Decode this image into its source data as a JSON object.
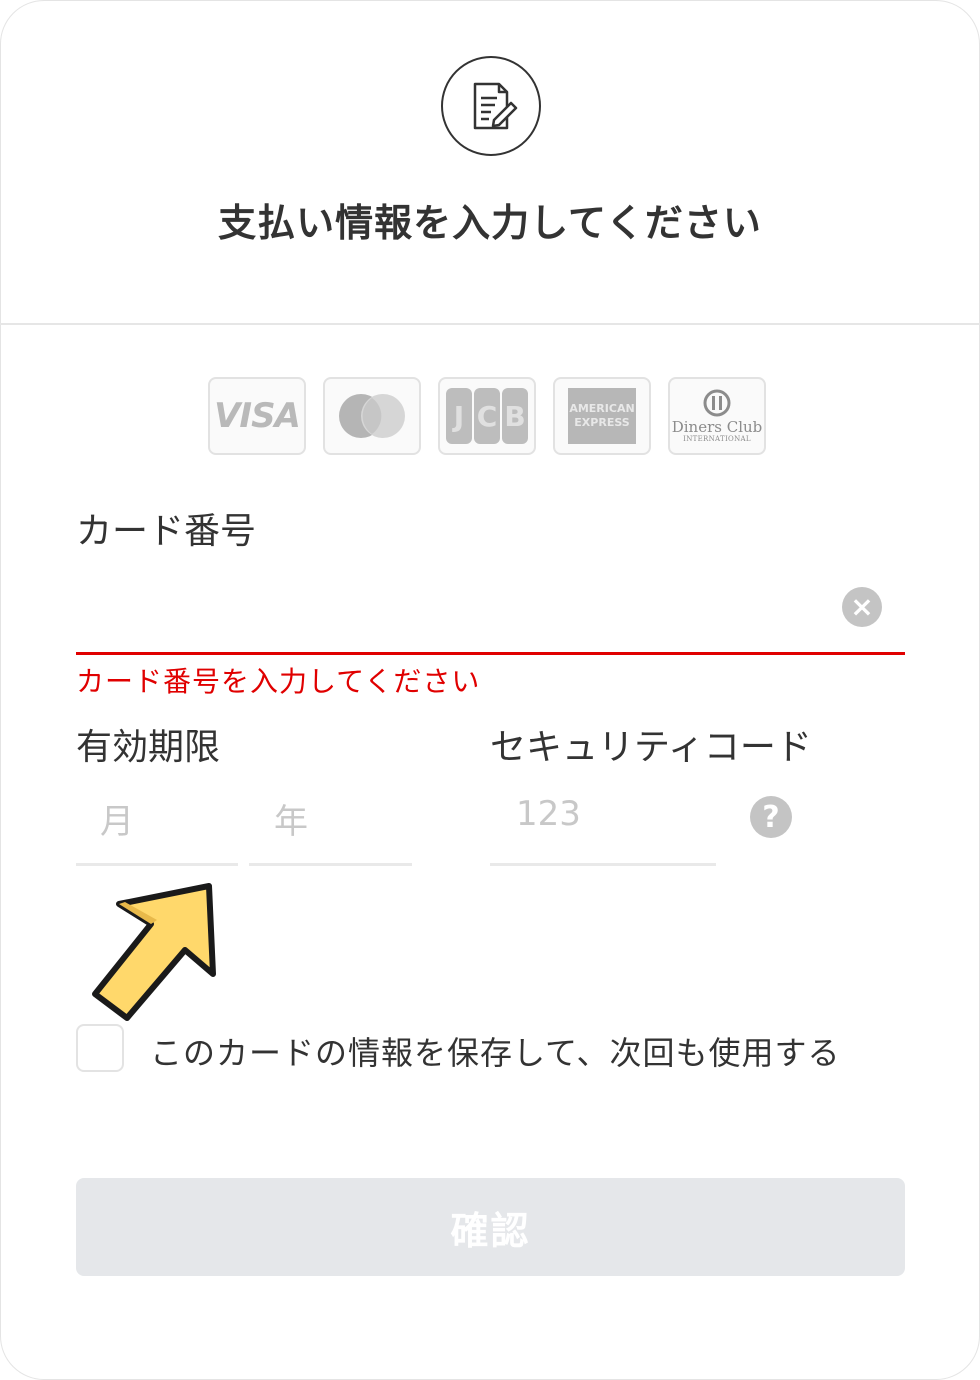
{
  "header": {
    "icon": "document-edit-icon",
    "title": "支払い情報を入力してください"
  },
  "brands": {
    "visa": "VISA",
    "jcb": [
      "J",
      "C",
      "B"
    ],
    "amex": [
      "AMERICAN",
      "EXPRESS"
    ],
    "diners": [
      "Diners Club",
      "INTERNATIONAL"
    ]
  },
  "card_number": {
    "label": "カード番号",
    "value": "",
    "error": "カード番号を入力してください"
  },
  "expiry": {
    "label": "有効期限",
    "month_placeholder": "月",
    "year_placeholder": "年"
  },
  "security": {
    "label": "セキュリティコード",
    "placeholder": "123",
    "help": "?"
  },
  "save_card": {
    "label": "このカードの情報を保存して、次回も使用する",
    "checked": false
  },
  "confirm_button": "確認",
  "colors": {
    "error": "#e00000",
    "arrow": "#ffd86b",
    "button_disabled": "#e5e7ea"
  }
}
